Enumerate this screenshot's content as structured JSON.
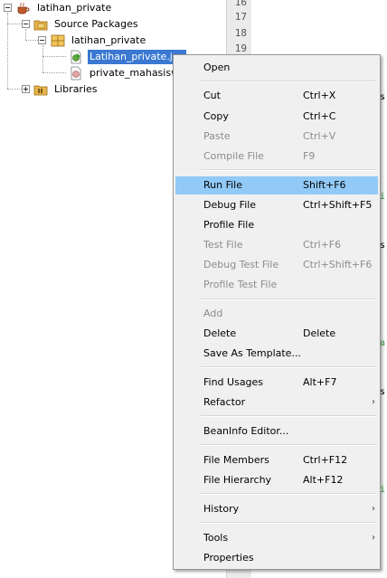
{
  "tree": {
    "project": "latihan_private",
    "source_packages": "Source Packages",
    "package": "latihan_private",
    "file_selected": "Latihan_private.jav",
    "file_other": "private_mahasiswa",
    "libraries": "Libraries"
  },
  "gutter": {
    "line_numbers": [
      "16",
      "17",
      "18",
      "19"
    ]
  },
  "menu": {
    "open": "Open",
    "cut": "Cut",
    "cut_sc": "Ctrl+X",
    "copy": "Copy",
    "copy_sc": "Ctrl+C",
    "paste": "Paste",
    "paste_sc": "Ctrl+V",
    "compile": "Compile File",
    "compile_sc": "F9",
    "run": "Run File",
    "run_sc": "Shift+F6",
    "debug": "Debug File",
    "debug_sc": "Ctrl+Shift+F5",
    "profile": "Profile File",
    "test": "Test File",
    "test_sc": "Ctrl+F6",
    "debug_test": "Debug Test File",
    "debug_test_sc": "Ctrl+Shift+F6",
    "profile_test": "Profile Test File",
    "add": "Add",
    "delete": "Delete",
    "delete_sc": "Delete",
    "save_template": "Save As Template...",
    "find_usages": "Find Usages",
    "find_usages_sc": "Alt+F7",
    "refactor": "Refactor",
    "beaninfo": "BeanInfo Editor...",
    "file_members": "File Members",
    "file_members_sc": "Ctrl+F12",
    "file_hierarchy": "File Hierarchy",
    "file_hierarchy_sc": "Alt+F12",
    "history": "History",
    "tools": "Tools",
    "properties": "Properties"
  },
  "colors": {
    "highlight": "#91c9f7",
    "selection": "#3a78d1",
    "menu_bg": "#f0f0f0",
    "disabled_text": "#8c8c8c"
  }
}
